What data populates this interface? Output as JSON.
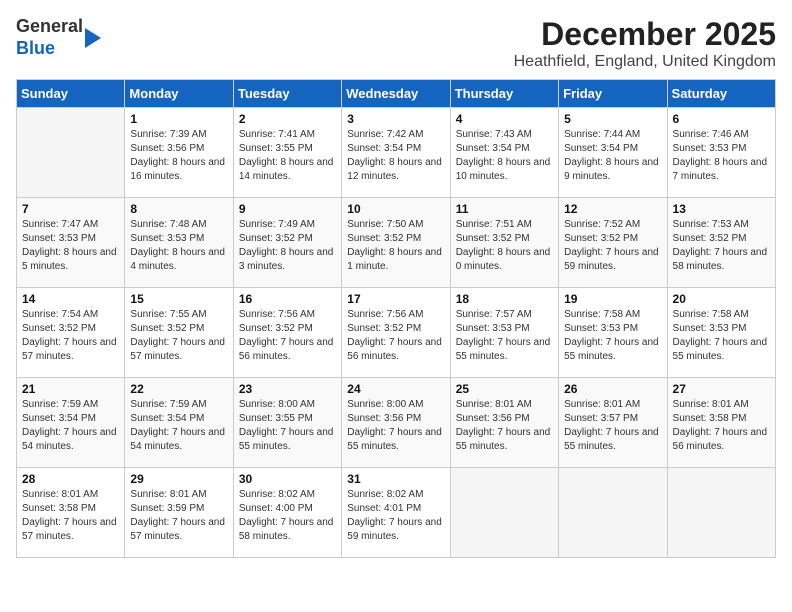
{
  "header": {
    "logo_line1": "General",
    "logo_line2": "Blue",
    "month": "December 2025",
    "location": "Heathfield, England, United Kingdom"
  },
  "days_of_week": [
    "Sunday",
    "Monday",
    "Tuesday",
    "Wednesday",
    "Thursday",
    "Friday",
    "Saturday"
  ],
  "weeks": [
    [
      {
        "day": "",
        "sunrise": "",
        "sunset": "",
        "daylight": "",
        "empty": true
      },
      {
        "day": "1",
        "sunrise": "Sunrise: 7:39 AM",
        "sunset": "Sunset: 3:56 PM",
        "daylight": "Daylight: 8 hours and 16 minutes."
      },
      {
        "day": "2",
        "sunrise": "Sunrise: 7:41 AM",
        "sunset": "Sunset: 3:55 PM",
        "daylight": "Daylight: 8 hours and 14 minutes."
      },
      {
        "day": "3",
        "sunrise": "Sunrise: 7:42 AM",
        "sunset": "Sunset: 3:54 PM",
        "daylight": "Daylight: 8 hours and 12 minutes."
      },
      {
        "day": "4",
        "sunrise": "Sunrise: 7:43 AM",
        "sunset": "Sunset: 3:54 PM",
        "daylight": "Daylight: 8 hours and 10 minutes."
      },
      {
        "day": "5",
        "sunrise": "Sunrise: 7:44 AM",
        "sunset": "Sunset: 3:54 PM",
        "daylight": "Daylight: 8 hours and 9 minutes."
      },
      {
        "day": "6",
        "sunrise": "Sunrise: 7:46 AM",
        "sunset": "Sunset: 3:53 PM",
        "daylight": "Daylight: 8 hours and 7 minutes."
      }
    ],
    [
      {
        "day": "7",
        "sunrise": "Sunrise: 7:47 AM",
        "sunset": "Sunset: 3:53 PM",
        "daylight": "Daylight: 8 hours and 5 minutes."
      },
      {
        "day": "8",
        "sunrise": "Sunrise: 7:48 AM",
        "sunset": "Sunset: 3:53 PM",
        "daylight": "Daylight: 8 hours and 4 minutes."
      },
      {
        "day": "9",
        "sunrise": "Sunrise: 7:49 AM",
        "sunset": "Sunset: 3:52 PM",
        "daylight": "Daylight: 8 hours and 3 minutes."
      },
      {
        "day": "10",
        "sunrise": "Sunrise: 7:50 AM",
        "sunset": "Sunset: 3:52 PM",
        "daylight": "Daylight: 8 hours and 1 minute."
      },
      {
        "day": "11",
        "sunrise": "Sunrise: 7:51 AM",
        "sunset": "Sunset: 3:52 PM",
        "daylight": "Daylight: 8 hours and 0 minutes."
      },
      {
        "day": "12",
        "sunrise": "Sunrise: 7:52 AM",
        "sunset": "Sunset: 3:52 PM",
        "daylight": "Daylight: 7 hours and 59 minutes."
      },
      {
        "day": "13",
        "sunrise": "Sunrise: 7:53 AM",
        "sunset": "Sunset: 3:52 PM",
        "daylight": "Daylight: 7 hours and 58 minutes."
      }
    ],
    [
      {
        "day": "14",
        "sunrise": "Sunrise: 7:54 AM",
        "sunset": "Sunset: 3:52 PM",
        "daylight": "Daylight: 7 hours and 57 minutes."
      },
      {
        "day": "15",
        "sunrise": "Sunrise: 7:55 AM",
        "sunset": "Sunset: 3:52 PM",
        "daylight": "Daylight: 7 hours and 57 minutes."
      },
      {
        "day": "16",
        "sunrise": "Sunrise: 7:56 AM",
        "sunset": "Sunset: 3:52 PM",
        "daylight": "Daylight: 7 hours and 56 minutes."
      },
      {
        "day": "17",
        "sunrise": "Sunrise: 7:56 AM",
        "sunset": "Sunset: 3:52 PM",
        "daylight": "Daylight: 7 hours and 56 minutes."
      },
      {
        "day": "18",
        "sunrise": "Sunrise: 7:57 AM",
        "sunset": "Sunset: 3:53 PM",
        "daylight": "Daylight: 7 hours and 55 minutes."
      },
      {
        "day": "19",
        "sunrise": "Sunrise: 7:58 AM",
        "sunset": "Sunset: 3:53 PM",
        "daylight": "Daylight: 7 hours and 55 minutes."
      },
      {
        "day": "20",
        "sunrise": "Sunrise: 7:58 AM",
        "sunset": "Sunset: 3:53 PM",
        "daylight": "Daylight: 7 hours and 55 minutes."
      }
    ],
    [
      {
        "day": "21",
        "sunrise": "Sunrise: 7:59 AM",
        "sunset": "Sunset: 3:54 PM",
        "daylight": "Daylight: 7 hours and 54 minutes."
      },
      {
        "day": "22",
        "sunrise": "Sunrise: 7:59 AM",
        "sunset": "Sunset: 3:54 PM",
        "daylight": "Daylight: 7 hours and 54 minutes."
      },
      {
        "day": "23",
        "sunrise": "Sunrise: 8:00 AM",
        "sunset": "Sunset: 3:55 PM",
        "daylight": "Daylight: 7 hours and 55 minutes."
      },
      {
        "day": "24",
        "sunrise": "Sunrise: 8:00 AM",
        "sunset": "Sunset: 3:56 PM",
        "daylight": "Daylight: 7 hours and 55 minutes."
      },
      {
        "day": "25",
        "sunrise": "Sunrise: 8:01 AM",
        "sunset": "Sunset: 3:56 PM",
        "daylight": "Daylight: 7 hours and 55 minutes."
      },
      {
        "day": "26",
        "sunrise": "Sunrise: 8:01 AM",
        "sunset": "Sunset: 3:57 PM",
        "daylight": "Daylight: 7 hours and 55 minutes."
      },
      {
        "day": "27",
        "sunrise": "Sunrise: 8:01 AM",
        "sunset": "Sunset: 3:58 PM",
        "daylight": "Daylight: 7 hours and 56 minutes."
      }
    ],
    [
      {
        "day": "28",
        "sunrise": "Sunrise: 8:01 AM",
        "sunset": "Sunset: 3:58 PM",
        "daylight": "Daylight: 7 hours and 57 minutes."
      },
      {
        "day": "29",
        "sunrise": "Sunrise: 8:01 AM",
        "sunset": "Sunset: 3:59 PM",
        "daylight": "Daylight: 7 hours and 57 minutes."
      },
      {
        "day": "30",
        "sunrise": "Sunrise: 8:02 AM",
        "sunset": "Sunset: 4:00 PM",
        "daylight": "Daylight: 7 hours and 58 minutes."
      },
      {
        "day": "31",
        "sunrise": "Sunrise: 8:02 AM",
        "sunset": "Sunset: 4:01 PM",
        "daylight": "Daylight: 7 hours and 59 minutes."
      },
      {
        "day": "",
        "sunrise": "",
        "sunset": "",
        "daylight": "",
        "empty": true
      },
      {
        "day": "",
        "sunrise": "",
        "sunset": "",
        "daylight": "",
        "empty": true
      },
      {
        "day": "",
        "sunrise": "",
        "sunset": "",
        "daylight": "",
        "empty": true
      }
    ]
  ]
}
